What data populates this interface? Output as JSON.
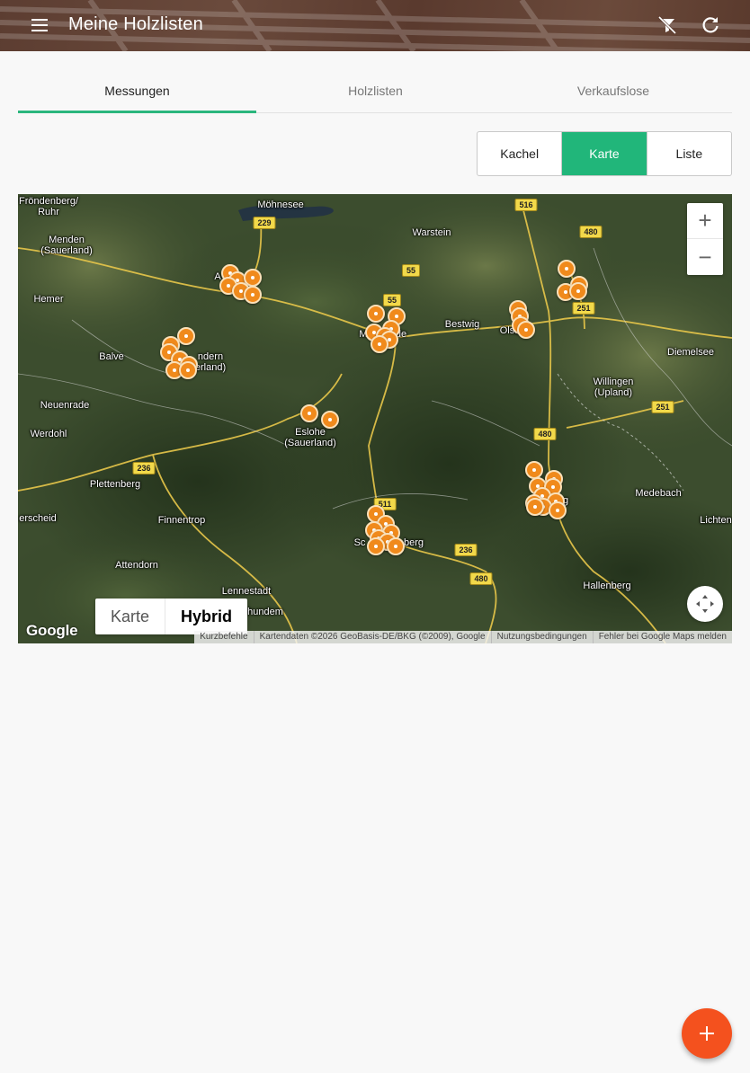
{
  "appbar": {
    "title": "Meine Holzlisten",
    "menu_icon": "menu-icon",
    "filter_off_icon": "filter-off-icon",
    "refresh_icon": "refresh-icon"
  },
  "tabs": [
    {
      "label": "Messungen",
      "active": true
    },
    {
      "label": "Holzlisten",
      "active": false
    },
    {
      "label": "Verkaufslose",
      "active": false
    }
  ],
  "view_toggle": [
    {
      "label": "Kachel",
      "active": false
    },
    {
      "label": "Karte",
      "active": true
    },
    {
      "label": "Liste",
      "active": false
    }
  ],
  "map": {
    "places": [
      "Fröndenberg/\nRuhr",
      "Möhnesee",
      "Warstein",
      "Menden\n(Sauerland)",
      "Hemer",
      "Balve",
      "Bestwig",
      "Olsberg",
      "Diemelsee",
      "Willingen\n(Upland)",
      "Neuenrade",
      "Werdohl",
      "Eslohe\n(Sauerland)",
      "Plettenberg",
      "Medebach",
      "Finnentrop",
      "Attendorn",
      "Lennestadt",
      "Hallenberg",
      "Lichten",
      "erscheid",
      "hhundem",
      "ndern\nerland)",
      "berg",
      "Sc",
      "g",
      "A",
      "M",
      "de",
      "Olsb"
    ],
    "roads": [
      "516",
      "480",
      "229",
      "55",
      "55",
      "251",
      "251",
      "480",
      "236",
      "511",
      "236",
      "480"
    ],
    "zoom_in": "+",
    "zoom_out": "−",
    "maptype": {
      "map": "Karte",
      "hybrid": "Hybrid",
      "active": "hybrid"
    },
    "logo": "Google",
    "attribution": [
      "Kurzbefehle",
      "Kartendaten ©2026 GeoBasis-DE/BKG (©2009), Google",
      "Nutzungsbedingungen",
      "Fehler bei Google Maps melden"
    ]
  },
  "fab": {
    "label": "+",
    "icon": "add-icon"
  },
  "colors": {
    "accent": "#21b67a",
    "appbar": "#5c3d31",
    "fab": "#f4511e",
    "marker": "#f08a1c"
  }
}
